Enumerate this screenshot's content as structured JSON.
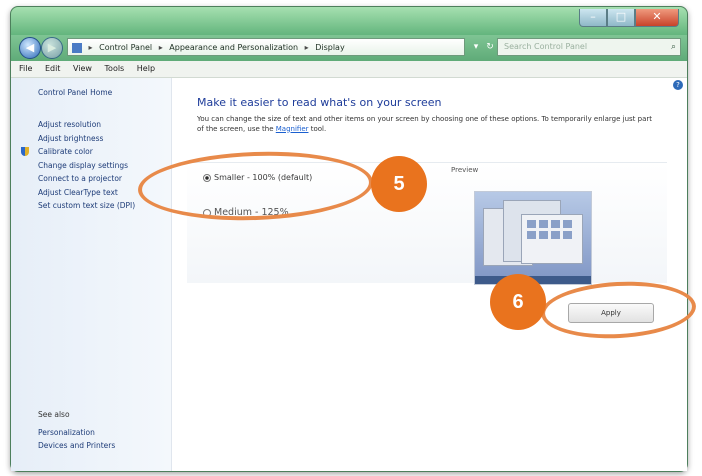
{
  "window": {
    "controls": {
      "minimize": "–",
      "maximize": "□",
      "close": "✕"
    }
  },
  "address": {
    "back": "◀",
    "forward": "▶",
    "breadcrumbs": [
      "Control Panel",
      "Appearance and Personalization",
      "Display"
    ],
    "separator": "▸",
    "dropdown": "▾",
    "refresh": "↻",
    "search_placeholder": "Search Control Panel",
    "search_icon": "⌕"
  },
  "menu": [
    "File",
    "Edit",
    "View",
    "Tools",
    "Help"
  ],
  "sidebar": {
    "home": "Control Panel Home",
    "links": [
      "Adjust resolution",
      "Adjust brightness",
      "Calibrate color",
      "Change display settings",
      "Connect to a projector",
      "Adjust ClearType text",
      "Set custom text size (DPI)"
    ],
    "see_also_heading": "See also",
    "see_also": [
      "Personalization",
      "Devices and Printers"
    ]
  },
  "main": {
    "help": "?",
    "title": "Make it easier to read what's on your screen",
    "description": "You can change the size of text and other items on your screen by choosing one of these options. To temporarily enlarge just part of the screen, use the",
    "description_link": "Magnifier",
    "description_tail": "tool.",
    "preview_label": "Preview",
    "options": [
      {
        "label": "Smaller - 100% (default)",
        "checked": true
      },
      {
        "label": "Medium - 125%",
        "checked": false
      }
    ],
    "apply_label": "Apply"
  },
  "annotations": {
    "badge_5": "5",
    "badge_6": "6",
    "color": "#e9731e"
  }
}
